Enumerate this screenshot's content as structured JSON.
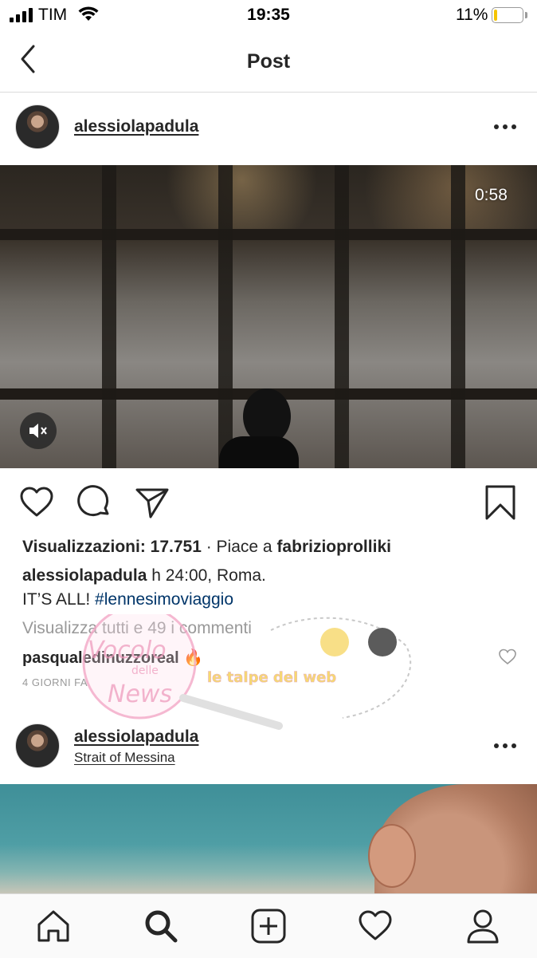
{
  "status_bar": {
    "carrier": "TIM",
    "time": "19:35",
    "battery_percent": "11%",
    "battery_level": 0.11,
    "battery_color": "#f5c400"
  },
  "nav": {
    "back_icon": "chevron-left-icon",
    "title": "Post"
  },
  "post": {
    "username": "alessiolapadula",
    "more_icon": "more-dots-icon",
    "video_duration": "0:58",
    "mute_icon": "speaker-muted-icon",
    "actions": {
      "like_icon": "heart-icon",
      "comment_icon": "comment-icon",
      "share_icon": "paper-plane-icon",
      "save_icon": "bookmark-icon"
    },
    "views_label": "Visualizzazioni: 17.751",
    "liked_by_prefix": " · Piace a ",
    "liked_by_user": "fabrizioprolliki",
    "caption_user": "alessiolapadula",
    "caption_text": " h 24:00, Roma.",
    "caption_line2": "IT’S ALL! ",
    "hashtag": "#lennesimoviaggio",
    "view_all_comments": "Visualizza tutti e 49 i commenti",
    "comment_user": "pasqualedinuzzoreal",
    "comment_text": " 🔥",
    "time_ago": "4 GIORNI FA",
    "hashtag_color": "#003569"
  },
  "post2": {
    "username": "alessiolapadula",
    "location": "Strait of Messina",
    "more_icon": "more-dots-icon"
  },
  "watermark": {
    "logo_text_1": "Vocolo",
    "logo_text_2": "delle",
    "logo_text_3": "News",
    "brand_text": "le talpe del web"
  },
  "tab_bar": {
    "items": [
      "home-icon",
      "search-icon",
      "add-post-icon",
      "activity-heart-icon",
      "profile-icon"
    ]
  }
}
